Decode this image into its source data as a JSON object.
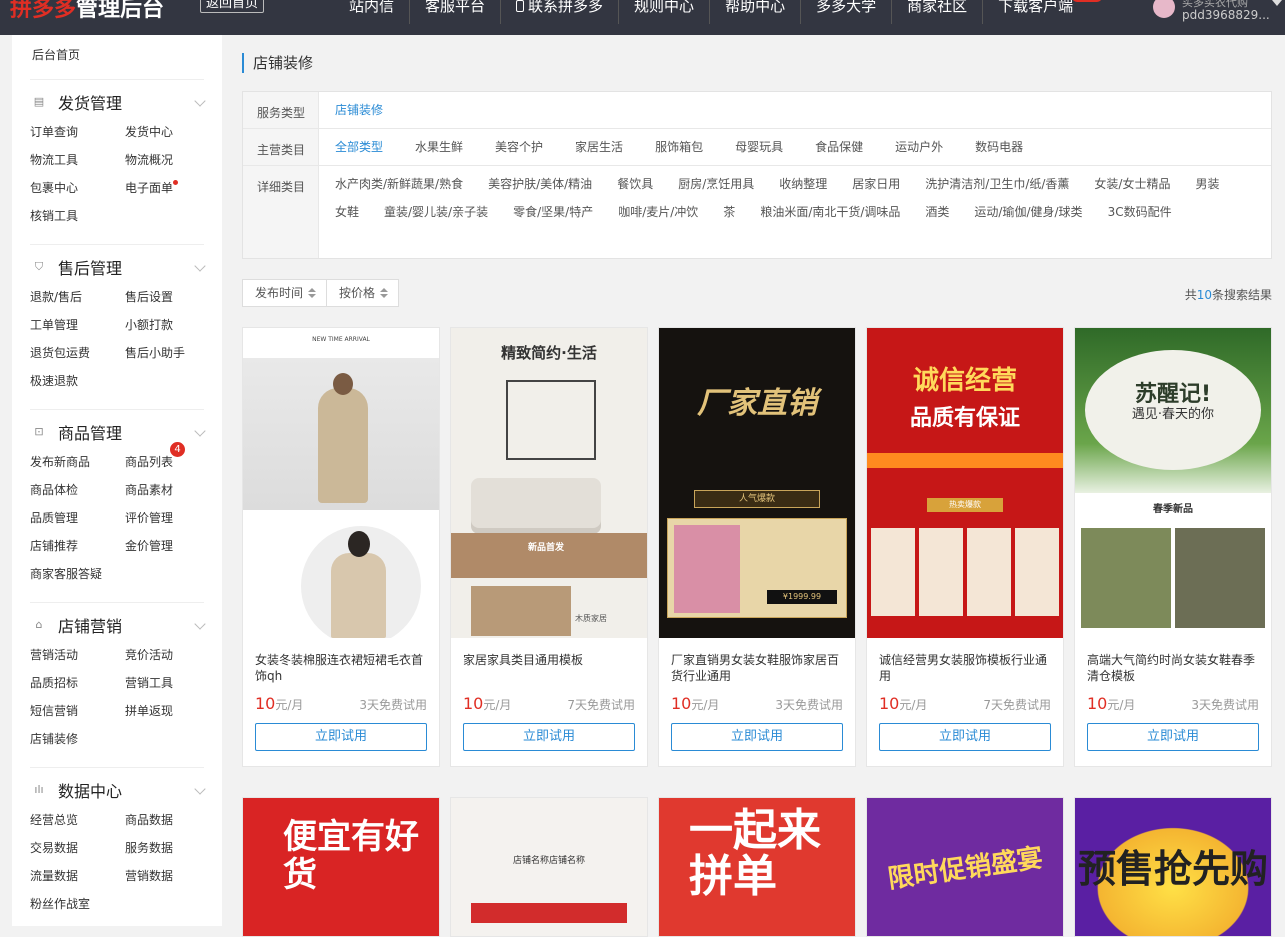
{
  "topbar": {
    "logo_red": "拼多多",
    "logo_white": "管理后台",
    "back_home": "返回首页",
    "nav": [
      "站内信",
      "客服平台",
      "联系拼多多",
      "规则中心",
      "帮助中心",
      "多多大学",
      "商家社区",
      "下载客户端"
    ],
    "user_name": "买多买农代购",
    "user_id": "pdd3968829..."
  },
  "sidebar": {
    "home": "后台首页",
    "sections": [
      {
        "icon": "document-icon",
        "title": "发货管理",
        "items": [
          "订单查询",
          "发货中心",
          "物流工具",
          "物流概况",
          "包裹中心",
          "电子面单",
          "核销工具"
        ]
      },
      {
        "icon": "shield-icon",
        "title": "售后管理",
        "items": [
          "退款/售后",
          "售后设置",
          "工单管理",
          "小额打款",
          "退货包运费",
          "售后小助手",
          "极速退款"
        ]
      },
      {
        "icon": "box-icon",
        "title": "商品管理",
        "items": [
          "发布新商品",
          "商品列表",
          "商品体检",
          "商品素材",
          "品质管理",
          "评价管理",
          "店铺推荐",
          "金价管理",
          "商家客服答疑"
        ],
        "badge": "4"
      },
      {
        "icon": "shop-icon",
        "title": "店铺营销",
        "items": [
          "营销活动",
          "竞价活动",
          "品质招标",
          "营销工具",
          "短信营销",
          "拼单返现",
          "店铺装修"
        ]
      },
      {
        "icon": "bar-chart-icon",
        "title": "数据中心",
        "items": [
          "经营总览",
          "商品数据",
          "交易数据",
          "服务数据",
          "流量数据",
          "营销数据",
          "粉丝作战室"
        ]
      }
    ]
  },
  "main": {
    "title": "店铺装修",
    "filter": {
      "service_label": "服务类型",
      "service_values": [
        "店铺装修"
      ],
      "category_label": "主营类目",
      "category_values": [
        "全部类型",
        "水果生鲜",
        "美容个护",
        "家居生活",
        "服饰箱包",
        "母婴玩具",
        "食品保健",
        "运动户外",
        "数码电器"
      ],
      "detail_label": "详细类目",
      "detail_values": [
        "水产肉类/新鲜蔬果/熟食",
        "美容护肤/美体/精油",
        "餐饮具",
        "厨房/烹饪用具",
        "收纳整理",
        "居家日用",
        "洗护清洁剂/卫生巾/纸/香薰",
        "女装/女士精品",
        "男装",
        "女鞋",
        "童装/婴儿装/亲子装",
        "零食/坚果/特产",
        "咖啡/麦片/冲饮",
        "茶",
        "粮油米面/南北干货/调味品",
        "酒类",
        "运动/瑜伽/健身/球类",
        "3C数码配件"
      ]
    },
    "sort": {
      "time": "发布时间",
      "price": "按价格"
    },
    "result": {
      "prefix": "共",
      "count": "10",
      "suffix": "条搜索结果"
    },
    "cards": [
      {
        "title": "女装冬装棉服连衣裙短裙毛衣首饰qh",
        "price": "10",
        "unit": "元/月",
        "trial": "3天免费试用",
        "button": "立即试用"
      },
      {
        "title": "家居家具类目通用模板",
        "price": "10",
        "unit": "元/月",
        "trial": "7天免费试用",
        "button": "立即试用"
      },
      {
        "title": "厂家直销男女装女鞋服饰家居百货行业通用",
        "price": "10",
        "unit": "元/月",
        "trial": "3天免费试用",
        "button": "立即试用"
      },
      {
        "title": "诚信经营男女装服饰模板行业通用",
        "price": "10",
        "unit": "元/月",
        "trial": "7天免费试用",
        "button": "立即试用"
      },
      {
        "title": "高端大气简约时尚女装女鞋春季清仓模板",
        "price": "10",
        "unit": "元/月",
        "trial": "3天免费试用",
        "button": "立即试用"
      }
    ],
    "thumb_text": {
      "a_cap": "NEW TIME ARRIVAL",
      "b_title": "精致简约·生活",
      "b_band": "新品首发",
      "b_cap": "木质家居",
      "c_title": "厂家直销",
      "c_tag": "人气爆款",
      "c_price": "¥1999.99",
      "d_t1": "诚信经营",
      "d_t2": "品质有保证",
      "d_hot": "热卖爆款",
      "e_t1": "苏醒记!",
      "e_t2": "遇见·春天的你",
      "e_new": "春季新品",
      "f_t1": "便宜有好货",
      "g_shop": "店铺名称店铺名称",
      "h_t1": "一起来拼单",
      "i_t1": "限时促销盛宴",
      "j_t1": "预售抢先购"
    }
  }
}
